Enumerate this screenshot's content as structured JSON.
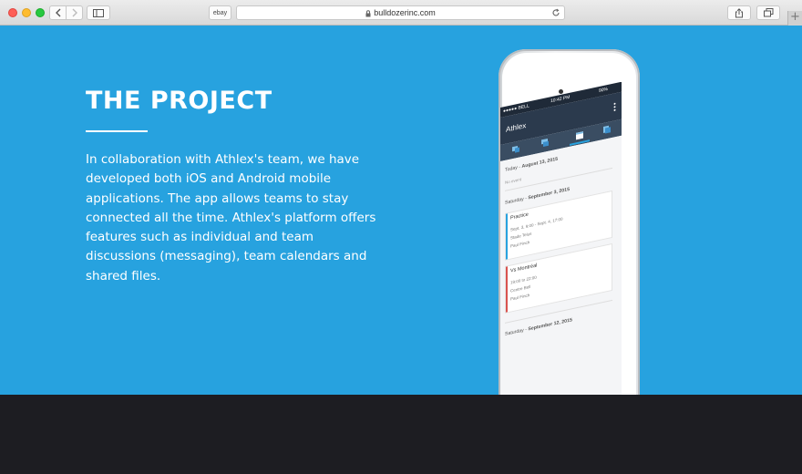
{
  "browser": {
    "favorite_label": "ebay",
    "url": "bulldozerinc.com",
    "new_tab_label": "+"
  },
  "page": {
    "title": "THE PROJECT",
    "paragraph": "In collaboration with Athlex's team, we have developed both iOS and Android mobile applications. The app allows teams to stay connected all the time. Athlex's platform offers features such as individual and team discussions (messaging), team calendars and shared files."
  },
  "phone_app": {
    "status_carrier": "●●●●● BELL",
    "status_time": "10:42 PM",
    "status_battery": "90%",
    "app_name": "Athlex",
    "today_heading_prefix": "Today",
    "today_heading_date": "August 13, 2015",
    "no_events": "No event",
    "day1_prefix": "Saturday",
    "day1_date": "September 3, 2015",
    "event1": {
      "title": "Practice",
      "time": "Sept. 3, 9:00 - Sept. 4, 17:00",
      "place": "Stade Telus",
      "person": "Paul Finch",
      "color": "#27a2df"
    },
    "event2": {
      "title": "Vs Montréal",
      "time": "19:00 to 22:00",
      "place": "Centre Bell",
      "person": "Paul Finch",
      "color": "#d9534f"
    },
    "day2_prefix": "Saturday",
    "day2_date": "September 12, 2015"
  },
  "colors": {
    "hero_bg": "#27a2df",
    "footer_bg": "#1d1d22"
  }
}
